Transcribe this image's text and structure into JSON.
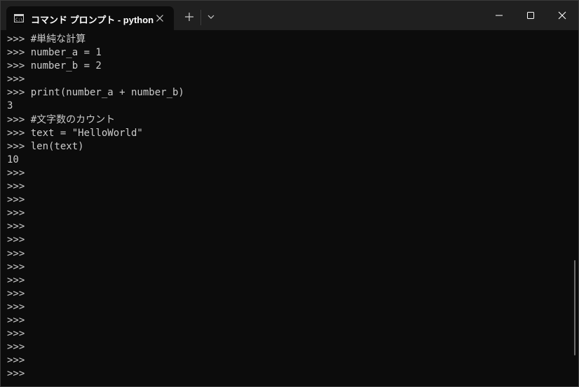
{
  "window": {
    "tab_title": "コマンド プロンプト - python"
  },
  "terminal": {
    "lines": [
      ">>> #単純な計算",
      ">>> number_a = 1",
      ">>> number_b = 2",
      ">>>",
      ">>> print(number_a + number_b)",
      "3",
      ">>> #文字数のカウント",
      ">>> text = \"HelloWorld\"",
      ">>> len(text)",
      "10",
      ">>>",
      ">>>",
      ">>>",
      ">>>",
      ">>>",
      ">>>",
      ">>>",
      ">>>",
      ">>>",
      ">>>",
      ">>>",
      ">>>",
      ">>>",
      ">>>",
      ">>>",
      ">>>"
    ]
  }
}
